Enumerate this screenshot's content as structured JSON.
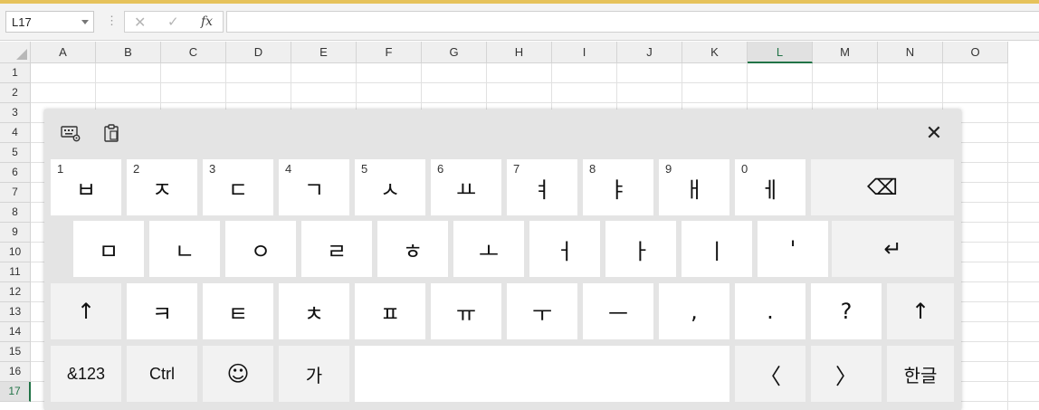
{
  "formula_bar": {
    "name_box": "L17",
    "separator": "⋮",
    "cancel": "✕",
    "enter": "✓",
    "fx": "fx",
    "content": ""
  },
  "sheet": {
    "columns": [
      "A",
      "B",
      "C",
      "D",
      "E",
      "F",
      "G",
      "H",
      "I",
      "J",
      "K",
      "L",
      "M",
      "N",
      "O"
    ],
    "rows": [
      "1",
      "2",
      "3",
      "4",
      "5",
      "6",
      "7",
      "8",
      "9",
      "10",
      "11",
      "12",
      "13",
      "14",
      "15",
      "16",
      "17"
    ],
    "selected_cell": {
      "column": "L",
      "row": "17"
    },
    "colors": {
      "selection": "#217346",
      "header_bg": "#efefef",
      "gridline": "#e1e1e1"
    }
  },
  "keyboard": {
    "toolbar": {
      "settings_icon": "keyboard-settings-icon",
      "clipboard_icon": "clipboard-icon",
      "close": "✕"
    },
    "row1": [
      {
        "num": "1",
        "label": "ㅂ"
      },
      {
        "num": "2",
        "label": "ㅈ"
      },
      {
        "num": "3",
        "label": "ㄷ"
      },
      {
        "num": "4",
        "label": "ㄱ"
      },
      {
        "num": "5",
        "label": "ㅅ"
      },
      {
        "num": "6",
        "label": "ㅛ"
      },
      {
        "num": "7",
        "label": "ㅕ"
      },
      {
        "num": "8",
        "label": "ㅑ"
      },
      {
        "num": "9",
        "label": "ㅐ"
      },
      {
        "num": "0",
        "label": "ㅔ"
      }
    ],
    "backspace": "⌫",
    "row2": [
      "ㅁ",
      "ㄴ",
      "ㅇ",
      "ㄹ",
      "ㅎ",
      "ㅗ",
      "ㅓ",
      "ㅏ",
      "ㅣ",
      "'"
    ],
    "enter": "↵",
    "shift": "↑",
    "row3": [
      "ㅋ",
      "ㅌ",
      "ㅊ",
      "ㅍ",
      "ㅠ",
      "ㅜ",
      "ㅡ",
      ",",
      ".",
      "?"
    ],
    "row4": {
      "symbols": "&123",
      "ctrl": "Ctrl",
      "emoji": "☺",
      "hangul_char": "가",
      "space": "",
      "left": "〈",
      "right": "〉",
      "language": "한글"
    }
  }
}
